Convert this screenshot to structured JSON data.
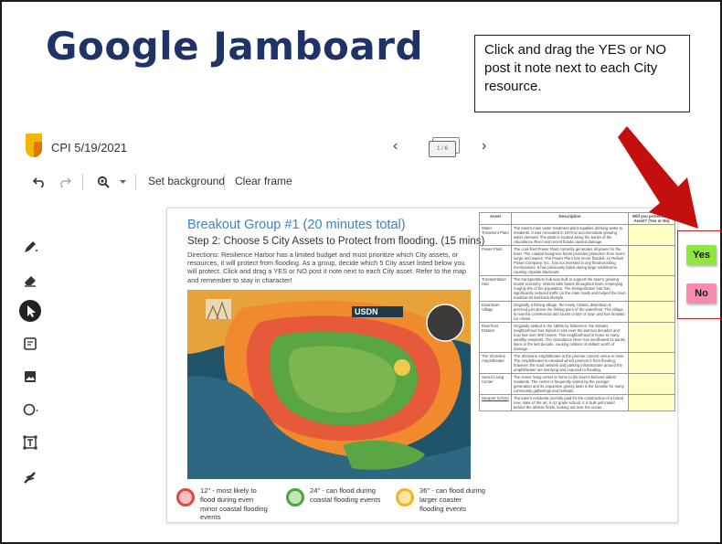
{
  "slide": {
    "title": "Google Jamboard",
    "callout": "Click and drag the YES or NO post it note next to each City resource."
  },
  "jamboard": {
    "doc_title": "CPI 5/19/2021",
    "frame_indicator": "1 / 6",
    "prev_icon": "‹",
    "next_icon": "›",
    "toolbar": {
      "set_background": "Set background",
      "clear_frame": "Clear frame"
    }
  },
  "frame": {
    "title": "Breakout Group #1 (20 minutes total)",
    "step": "Step 2: Choose 5 City Assets to Protect from flooding. (15 mins)",
    "directions": "Directions: Resilience Harbor has a limited budget and must prioritize which City assets, or resources, it will protect from flooding. As a group, decide which 5 City asset listed below you will protect. Click and drag a YES or NO post it note next to each City asset. Refer to the map and remember to stay in character!",
    "map_brand": "USDN",
    "legend": [
      {
        "text": "12\" - most likely to flood during even minor coastal flooding events",
        "color": "#e04848"
      },
      {
        "text": "24\" - can flood during coastal flooding events",
        "color": "#4aa33c"
      },
      {
        "text": "36\" - can flood during larger coaster flooding events",
        "color": "#f2b51d"
      }
    ],
    "table": {
      "headers": [
        "Asset",
        "Description",
        "Will you protect this Asset? (Yes or No)"
      ],
      "rows": [
        {
          "asset": "Water Treatment Plant",
          "desc": "The town's main water treatment plant supplies drinking water to residents. It was renovated in 1970 to accommodate growing water demand. The plant is located along the banks of the Abundance River and recent floods caused damage."
        },
        {
          "asset": "Power Plant",
          "desc": "The coal-fired Power Plant currently generates all power for the town. The coastal mangrove forest provides protection from storm surge and waves. The Power Plant has never flooded, so Reliant Power Company, Inc., has not invested in any flood-proofing mechanisms. It has previously failed during large windstorms, causing citywide blackouts."
        },
        {
          "asset": "Transportation Hub",
          "desc": "The transportation hub was built to support the town's growing tourist economy. Visitors take buses throughout town, employing roughly 5% of the population. The transportation hub has significantly reduced traffic on the main roads and helped the town maintain its laid-back lifestyle."
        },
        {
          "asset": "Downtown Village",
          "desc": "Originally a fishing village, the lovely, historic downtown is perched just above the fishing piers of the waterfront. The village is now the commercial and tourist center of town and has fantastic ice cream."
        },
        {
          "asset": "Riverfront Estates",
          "desc": "Originally settled in the 1800s by fishermen, the Estates neighborhood has tripled in size over the last two decades and now has over 300 homes. This neighborhood is home to many wealthy residents. The Abundance River has overflowed its banks twice in the last decade, causing millions of dollars' worth of damage."
        },
        {
          "asset": "The Shoreline Amphitheater",
          "desc": "The Shoreline Amphitheater is the premier concert venue in town. The Amphitheater is elevated which protects it from flooding; however, the road network and parking infrastructure around the amphitheater are low-lying and exposed to flooding."
        },
        {
          "asset": "Senior Living Center",
          "desc": "The senior living center is home to the town's beloved oldest residents. The center is frequently visited by the younger generation and its expansive grassy lawn is the location for many community gatherings and festivals."
        },
        {
          "asset": "Newport School",
          "desc": "The town's residents recently paid for the construction of a brand new, state of the art, K-12 grade school. It is built just inland behind the athletic fields, looking out over the ocean."
        }
      ]
    }
  },
  "stickies": {
    "yes": {
      "label": "Yes",
      "color": "#8fe63f"
    },
    "no": {
      "label": "No",
      "color": "#f68ab0"
    }
  },
  "colors": {
    "title_navy": "#1f3366",
    "frame_blue": "#3d83c6",
    "highlight_red": "#d11e1e"
  },
  "icons": {
    "undo": "undo-icon",
    "redo": "redo-icon",
    "zoom": "zoom-icon",
    "pen": "pen-icon",
    "eraser": "eraser-icon",
    "select": "select-cursor-icon",
    "sticky_note": "sticky-note-icon",
    "image": "image-icon",
    "shape": "circle-shape-icon",
    "text_box": "text-box-icon",
    "laser": "laser-icon"
  }
}
